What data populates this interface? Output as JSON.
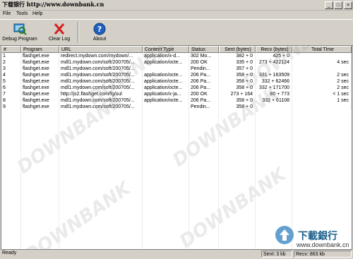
{
  "window": {
    "title": "下载银行 http://www.downbank.cn"
  },
  "menu": {
    "items": [
      {
        "label": "File"
      },
      {
        "label": "Tools"
      },
      {
        "label": "Help"
      }
    ]
  },
  "toolbar": {
    "debug_label": "Debug Program",
    "clear_label": "Clear Log",
    "about_label": "About"
  },
  "table": {
    "columns": [
      "#",
      "Program",
      "URL",
      "Content Type",
      "Status",
      "Sent (bytes)",
      "Recv (bytes)",
      "Total Time"
    ],
    "rows": [
      [
        "1",
        "flashget.exe",
        "redirect.mydown.com/mydown/...",
        "application/x-d...",
        "302 Mo...",
        "382 + 0",
        "425 + 0",
        ""
      ],
      [
        "2",
        "flashget.exe",
        "mdl1.mydown.com/soft/200705/...",
        "application/octe...",
        "200 OK",
        "335 + 0",
        "273 + 422124",
        "4 sec"
      ],
      [
        "3",
        "flashget.exe",
        "mdl1.mydown.com/soft/200705/...",
        "",
        "Pendin...",
        "357 + 0",
        "",
        ""
      ],
      [
        "4",
        "flashget.exe",
        "mdl1.mydown.com/soft/200705/...",
        "application/octe...",
        "206 Pa...",
        "358 + 0",
        "331 + 163509",
        "2 sec"
      ],
      [
        "5",
        "flashget.exe",
        "mdl1.mydown.com/soft/200705/...",
        "application/octe...",
        "206 Pa...",
        "358 + 0",
        "332 + 62466",
        "2 sec"
      ],
      [
        "6",
        "flashget.exe",
        "mdl1.mydown.com/soft/200705/...",
        "application/octe...",
        "206 Pa...",
        "358 + 0",
        "332 + 171700",
        "2 sec"
      ],
      [
        "7",
        "flashget.exe",
        "http://js2.flashget.com/fg/sul",
        "application/x-ja...",
        "200 OK",
        "273 + 164",
        "80 + 773",
        "< 1 sec"
      ],
      [
        "8",
        "flashget.exe",
        "mdl1.mydown.com/soft/200705/...",
        "application/octe...",
        "206 Pa...",
        "358 + 0",
        "332 + 61108",
        "1 sec"
      ],
      [
        "9",
        "flashget.exe",
        "mdl1.mydown.com/soft/200705/...",
        "",
        "Pendin...",
        "358 + 0",
        "",
        ""
      ]
    ]
  },
  "status": {
    "text": "Ready",
    "sent": "Sent: 3 kb",
    "recv": "Recv: 863 kb"
  },
  "watermark": {
    "text": "DOWNBANK",
    "logo_text": "下載銀行",
    "logo_url": "www.downbank.cn"
  }
}
